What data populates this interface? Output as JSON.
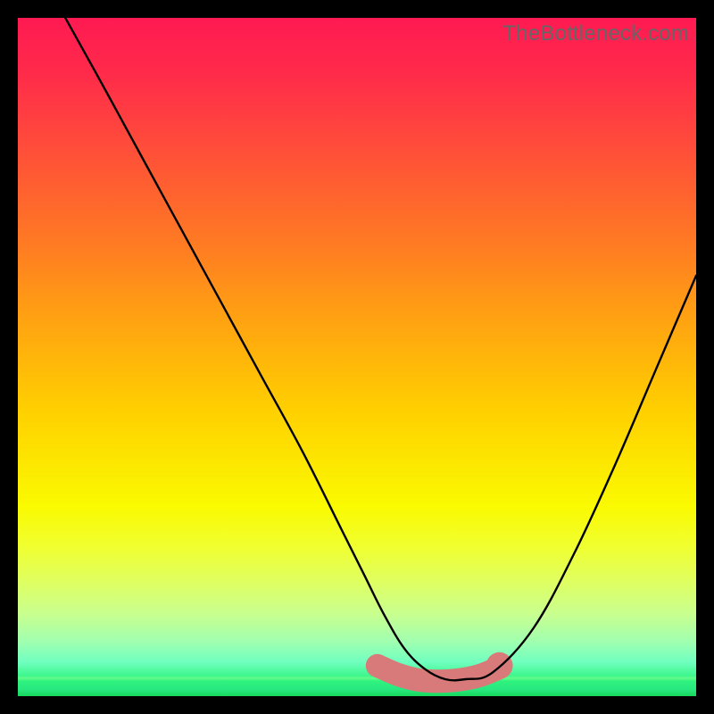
{
  "watermark": "TheBottleneck.com",
  "chart_data": {
    "type": "line",
    "title": "",
    "xlabel": "",
    "ylabel": "",
    "xlim": [
      0,
      100
    ],
    "ylim": [
      0,
      100
    ],
    "background": "vertical-gradient red-yellow-green",
    "series": [
      {
        "name": "bottleneck-curve",
        "role": "main-curve",
        "color": "#000000",
        "x": [
          7,
          12,
          18,
          24,
          30,
          36,
          42,
          48,
          51,
          54,
          57,
          60,
          63,
          66,
          70,
          76,
          82,
          88,
          94,
          100
        ],
        "y": [
          100,
          91,
          80,
          69,
          58,
          47,
          36,
          24,
          18,
          12,
          7,
          4,
          2.5,
          2.5,
          3.5,
          10,
          21,
          34,
          48,
          62
        ]
      },
      {
        "name": "optimal-range-highlight",
        "role": "highlight",
        "color": "#d97a7a",
        "x": [
          53,
          56,
          59,
          62,
          65,
          68,
          71
        ],
        "y": [
          4.5,
          3.2,
          2.4,
          2.2,
          2.4,
          3.0,
          4.2
        ]
      }
    ],
    "markers": [
      {
        "name": "highlight-end-dot",
        "x": 71,
        "y": 4.5,
        "r": 15,
        "color": "#d97a7a"
      }
    ],
    "gradient_stops": [
      {
        "pos": 0,
        "color": "#ff1a52"
      },
      {
        "pos": 50,
        "color": "#ffd000"
      },
      {
        "pos": 78,
        "color": "#f0ff30"
      },
      {
        "pos": 100,
        "color": "#18d85c"
      }
    ]
  }
}
